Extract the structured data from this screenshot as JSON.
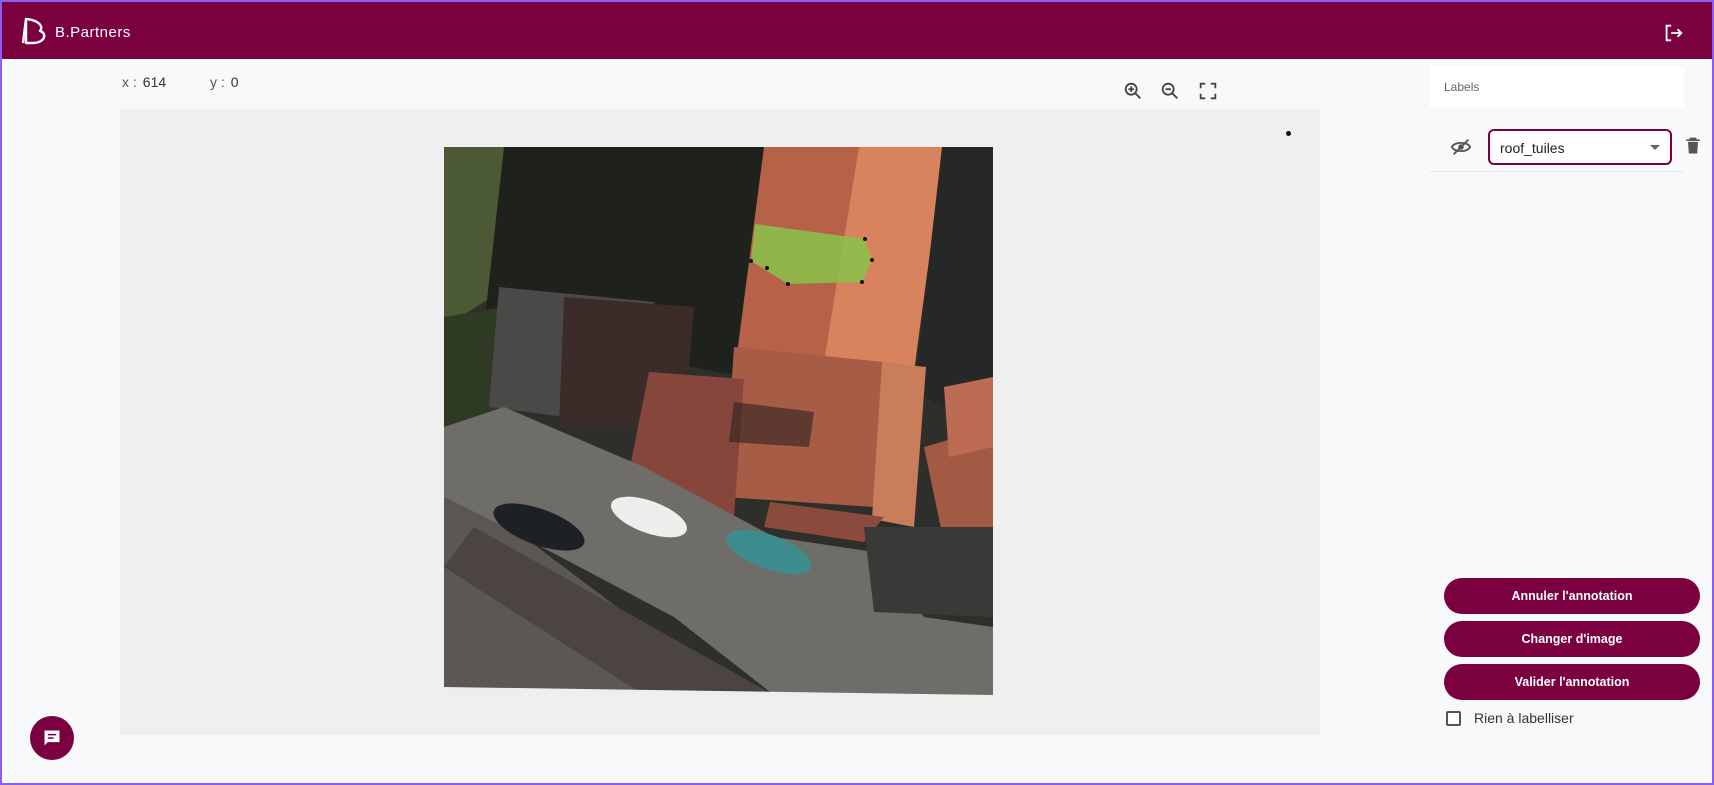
{
  "app": {
    "brand": "B.Partners"
  },
  "icons": {
    "logo": "brand-logo-icon",
    "logout": "logout-icon",
    "zoom_in": "zoom-in-icon",
    "zoom_out": "zoom-out-icon",
    "fullscreen": "fullscreen-icon",
    "visibility": "eye-off-icon",
    "delete": "trash-icon",
    "chat": "chat-icon"
  },
  "cursor": {
    "x_label": "x :",
    "x_value": "614",
    "y_label": "y :",
    "y_value": "0"
  },
  "labels_panel": {
    "title": "Labels",
    "selected_label": "roof_tuiles"
  },
  "actions": {
    "cancel": "Annuler l'annotation",
    "change": "Changer d'image",
    "validate": "Valider l'annotation"
  },
  "nothing_to_label": {
    "label": "Rien à labelliser",
    "checked": false
  },
  "colors": {
    "brand": "#7a0040",
    "annotation": "#8bc34a"
  }
}
